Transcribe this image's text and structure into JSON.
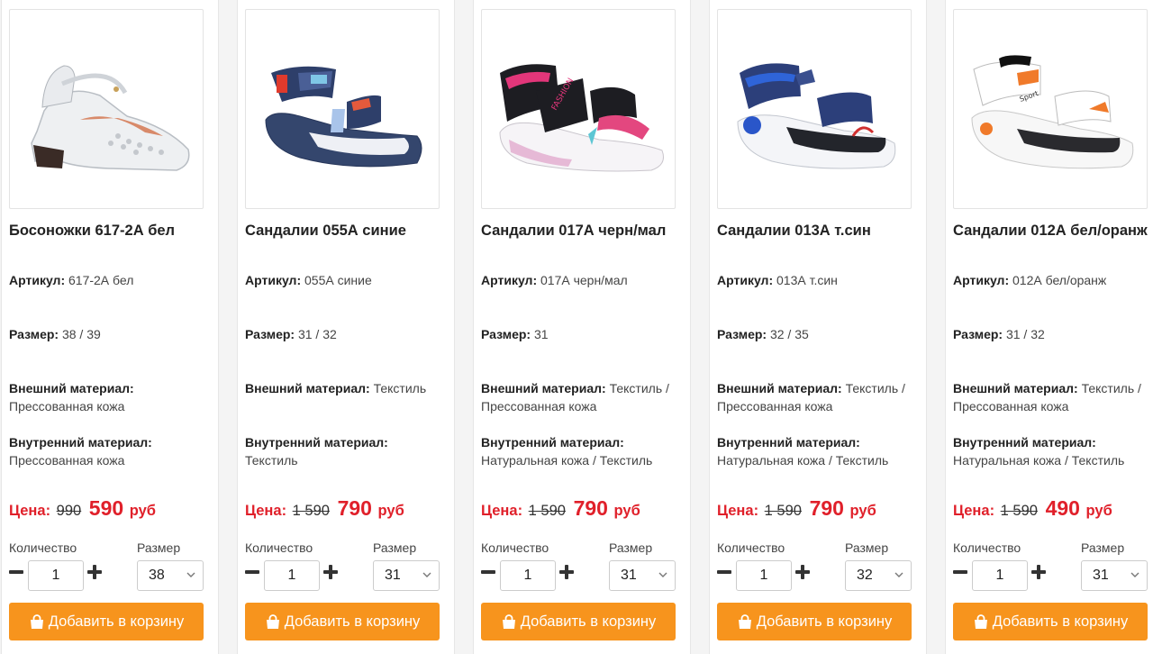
{
  "labels": {
    "article": "Артикул:",
    "size": "Размер:",
    "outer": "Внешний материал:",
    "inner": "Внутренний материал:",
    "price": "Цена:",
    "currency": "руб",
    "quantity": "Количество",
    "size_select": "Размер",
    "add_to_cart": "Добавить в корзину"
  },
  "colors": {
    "accent": "#f7941d",
    "price_red": "#e0202a"
  },
  "icons": {
    "cart": "shopping-bag-icon",
    "minus": "minus-icon",
    "plus": "plus-icon",
    "select": "chevron-down-icon"
  },
  "products": [
    {
      "title": "Босоножки 617-2А бел",
      "article": "617-2А бел",
      "size": "38 / 39",
      "outer": "Прессованная кожа",
      "inner": "Прессованная кожа",
      "old_price": "990",
      "new_price": "590",
      "qty": "1",
      "selected_size": "38"
    },
    {
      "title": "Сандалии 055А синие",
      "article": "055А синие",
      "size": "31 / 32",
      "outer": "Текстиль",
      "inner": "Текстиль",
      "old_price": "1 590",
      "new_price": "790",
      "qty": "1",
      "selected_size": "31"
    },
    {
      "title": "Сандалии 017А черн/мал",
      "article": "017А черн/мал",
      "size": "31",
      "outer": "Текстиль / Прессованная кожа",
      "inner": "Натуральная кожа / Текстиль",
      "old_price": "1 590",
      "new_price": "790",
      "qty": "1",
      "selected_size": "31"
    },
    {
      "title": "Сандалии 013А т.син",
      "article": "013А т.син",
      "size": "32 / 35",
      "outer": "Текстиль / Прессованная кожа",
      "inner": "Натуральная кожа / Текстиль",
      "old_price": "1 590",
      "new_price": "790",
      "qty": "1",
      "selected_size": "32"
    },
    {
      "title": "Сандалии 012А бел/оранж",
      "article": "012А бел/оранж",
      "size": "31 / 32",
      "outer": "Текстиль / Прессованная кожа",
      "inner": "Натуральная кожа / Текстиль",
      "old_price": "1 590",
      "new_price": "490",
      "qty": "1",
      "selected_size": "31"
    }
  ]
}
